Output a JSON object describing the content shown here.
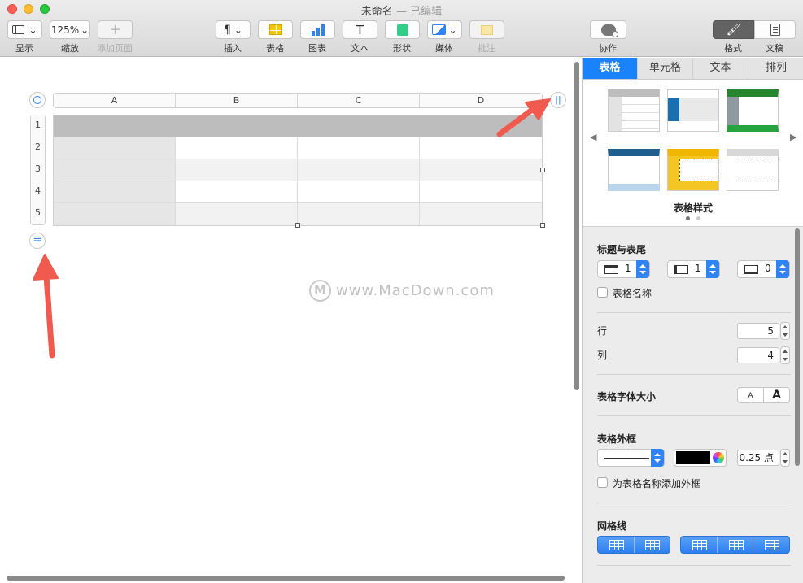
{
  "window": {
    "title": "未命名",
    "subtitle": "— 已编辑"
  },
  "toolbar": {
    "view_label": "显示",
    "zoom_value": "125%",
    "zoom_label": "缩放",
    "add_page_label": "添加页面",
    "insert_label": "插入",
    "table_label": "表格",
    "chart_label": "图表",
    "text_label": "文本",
    "shape_label": "形状",
    "media_label": "媒体",
    "comment_label": "批注",
    "collab_label": "协作",
    "format_label": "格式",
    "document_label": "文稿"
  },
  "table": {
    "columns": [
      "A",
      "B",
      "C",
      "D"
    ],
    "rows": [
      "1",
      "2",
      "3",
      "4",
      "5"
    ]
  },
  "watermark": "www.MacDown.com",
  "inspector": {
    "tabs": [
      "表格",
      "单元格",
      "文本",
      "排列"
    ],
    "styles_label": "表格样式",
    "header_footer": {
      "title": "标题与表尾",
      "header_rows": "1",
      "header_cols": "1",
      "footer_rows": "0"
    },
    "table_name_label": "表格名称",
    "rows_label": "行",
    "rows_value": "5",
    "cols_label": "列",
    "cols_value": "4",
    "font_size_label": "表格字体大小",
    "font_small": "A",
    "font_large": "A",
    "outline": {
      "title": "表格外框",
      "width": "0.25 点",
      "name_outline_label": "为表格名称添加外框"
    },
    "gridlines_title": "网格线"
  },
  "colors": {
    "accent": "#1a82fb",
    "header_row": "#bdbdbd",
    "arrow": "#f05a4f"
  }
}
